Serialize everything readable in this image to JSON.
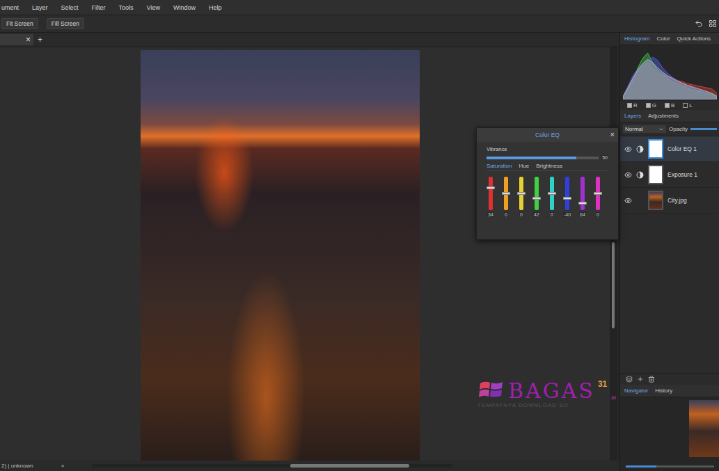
{
  "menu": [
    "ument",
    "Layer",
    "Select",
    "Filter",
    "Tools",
    "View",
    "Window",
    "Help"
  ],
  "toolbar": {
    "buttons": [
      "Fit Screen",
      "Fill Screen"
    ]
  },
  "document_tabs": {
    "close": "×",
    "add": "+"
  },
  "status_bar": {
    "text": "2) | unknown",
    "close": "×",
    "scroll_level": 0.33
  },
  "right_panel": {
    "top_tabs": [
      {
        "label": "Histogram",
        "selected": true
      },
      {
        "label": "Color",
        "selected": false
      },
      {
        "label": "Quick Actions",
        "selected": false
      }
    ],
    "histogram": {
      "series": [
        {
          "name": "R",
          "color": "#d04040",
          "values": [
            5,
            20,
            38,
            55,
            62,
            70,
            58,
            50,
            46,
            44,
            40,
            36,
            34,
            30,
            28,
            26,
            24,
            22,
            20,
            12
          ]
        },
        {
          "name": "G",
          "color": "#40c040",
          "values": [
            4,
            18,
            35,
            60,
            78,
            88,
            70,
            55,
            48,
            40,
            34,
            30,
            26,
            22,
            18,
            16,
            14,
            12,
            10,
            6
          ]
        },
        {
          "name": "B",
          "color": "#5060e0",
          "values": [
            6,
            25,
            45,
            58,
            66,
            72,
            80,
            74,
            60,
            50,
            42,
            36,
            30,
            26,
            22,
            18,
            16,
            12,
            8,
            4
          ]
        },
        {
          "name": "L",
          "color": "#b0b0b0",
          "values": [
            5,
            22,
            40,
            56,
            68,
            76,
            70,
            60,
            52,
            45,
            40,
            35,
            31,
            27,
            24,
            21,
            18,
            15,
            12,
            6
          ]
        }
      ]
    },
    "channel_checks": [
      {
        "label": "R",
        "checked": true
      },
      {
        "label": "G",
        "checked": true
      },
      {
        "label": "B",
        "checked": true
      },
      {
        "label": "L",
        "checked": false
      }
    ],
    "layer_tabs": [
      {
        "label": "Layers",
        "selected": true
      },
      {
        "label": "Adjustments",
        "selected": false
      }
    ],
    "blend_mode": "Normal",
    "opacity": {
      "label": "Opacity",
      "level": 1
    },
    "layers": [
      {
        "name": "Color EQ 1",
        "kind": "adjustment",
        "visible": true,
        "selected": true
      },
      {
        "name": "Exposure 1",
        "kind": "adjustment",
        "visible": true,
        "selected": false
      },
      {
        "name": "City.jpg",
        "kind": "image",
        "visible": true,
        "selected": false
      }
    ],
    "bottom_tabs": [
      {
        "label": "Navigator",
        "selected": true
      },
      {
        "label": "History",
        "selected": false
      }
    ],
    "zoom_level": 0.35
  },
  "color_eq": {
    "title": "Color EQ",
    "close": "×",
    "vibrance": {
      "label": "Vibrance",
      "level": 0.8,
      "reading": "50"
    },
    "modes": [
      {
        "label": "Saturation",
        "selected": true
      },
      {
        "label": "Hue",
        "selected": false
      },
      {
        "label": "Brightness",
        "selected": false
      }
    ],
    "sliders": [
      {
        "color": "#e03030",
        "level": 0.69,
        "value": "34"
      },
      {
        "color": "#f0a020",
        "level": 0.5,
        "value": "0"
      },
      {
        "color": "#e8d030",
        "level": 0.5,
        "value": "0"
      },
      {
        "color": "#40d040",
        "level": 0.33,
        "value": "42"
      },
      {
        "color": "#30d0c8",
        "level": 0.5,
        "value": "0"
      },
      {
        "color": "#3040e0",
        "level": 0.33,
        "value": "-40"
      },
      {
        "color": "#a030d0",
        "level": 0.19,
        "value": "64"
      },
      {
        "color": "#e030c0",
        "level": 0.5,
        "value": "0"
      }
    ]
  },
  "watermark": {
    "brand": "BAGAS",
    "number": "31",
    "domain": ".id",
    "tagline": "TEMPATNYA DOWNLOAD SO"
  }
}
